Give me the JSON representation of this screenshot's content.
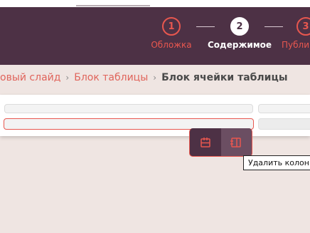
{
  "stepper": {
    "steps": [
      {
        "number": "1",
        "label": "Обложка"
      },
      {
        "number": "2",
        "label": "Содержимое"
      },
      {
        "number": "3",
        "label": "Публи"
      }
    ]
  },
  "breadcrumb": {
    "items": [
      "овый слайд",
      "Блок таблицы"
    ],
    "current": "Блок ячейки таблицы",
    "separator": "›"
  },
  "toolbar": {
    "buttons": [
      {
        "icon": "delete-row-icon"
      },
      {
        "icon": "delete-column-icon"
      }
    ]
  },
  "tooltip": {
    "text": "Удалить колонку"
  },
  "colors": {
    "header_bg": "#4d3145",
    "accent": "#e8574f",
    "page_bg": "#efe5e2"
  }
}
